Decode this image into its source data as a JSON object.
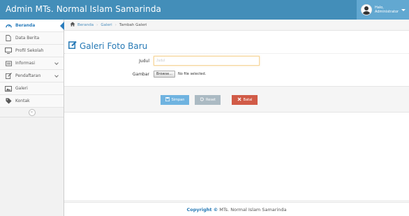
{
  "app": {
    "title": "Admin MTs. Normal Islam Samarinda"
  },
  "user": {
    "greeting": "Halo,",
    "name": "Administrator"
  },
  "sidebar": {
    "items": [
      {
        "label": "Beranda",
        "icon": "tachometer-icon"
      },
      {
        "label": "Data Berita",
        "icon": "file-icon"
      },
      {
        "label": "Profil Sekolah",
        "icon": "desktop-icon"
      },
      {
        "label": "Informasi",
        "icon": "list-icon"
      },
      {
        "label": "Pendaftaran",
        "icon": "edit-icon"
      },
      {
        "label": "Galeri",
        "icon": "picture-icon"
      },
      {
        "label": "Kontak",
        "icon": "tag-icon"
      }
    ],
    "collapse_glyph": "«"
  },
  "breadcrumb": {
    "home": "Beranda",
    "section": "Galeri",
    "current": "Tambah Galeri"
  },
  "page": {
    "title": "Galeri Foto Baru"
  },
  "form": {
    "judul_label": "Judul",
    "judul_placeholder": "Judul",
    "judul_value": "",
    "gambar_label": "Gambar",
    "browse_label": "Browse...",
    "file_status": "No file selected."
  },
  "actions": {
    "save": "Simpan",
    "reset": "Reset",
    "cancel": "Batal"
  },
  "footer": {
    "brand": "Copyright ©",
    "text": "MTs. Normal Islam Samarinda"
  },
  "colors": {
    "navbar": "#438eb9",
    "accent": "#2679b5",
    "save": "#6fb3e0",
    "reset": "#abbac3",
    "cancel": "#d15b47"
  }
}
